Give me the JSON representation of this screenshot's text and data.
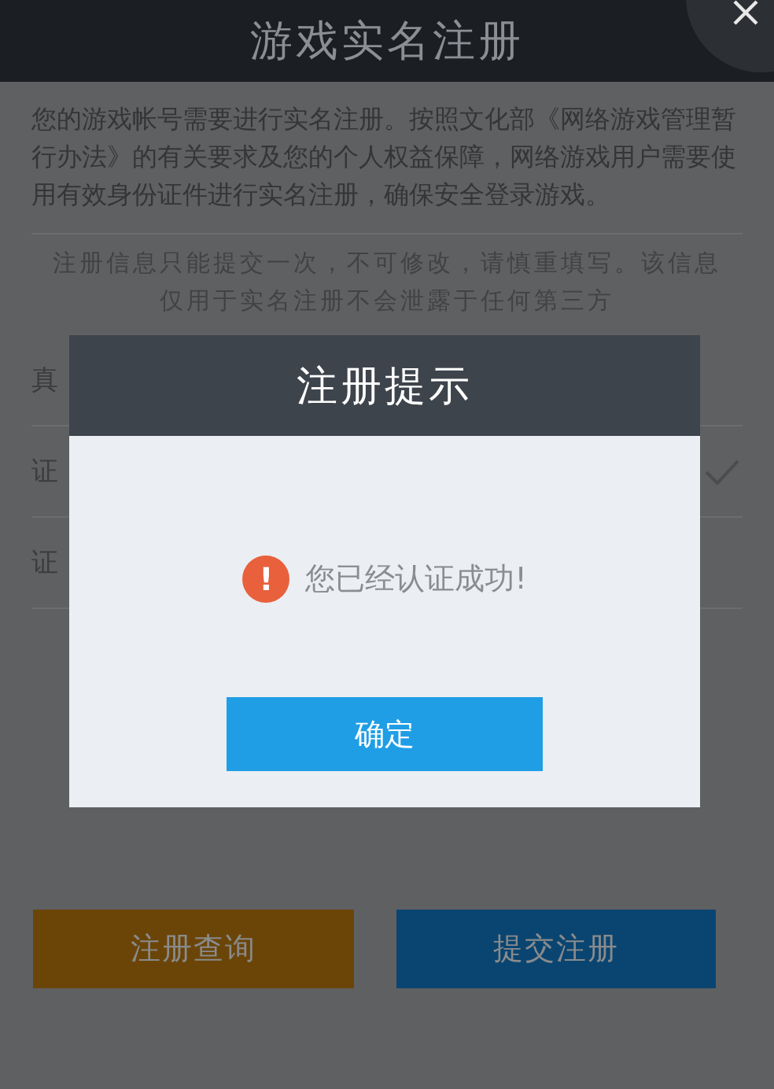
{
  "header": {
    "title": "游戏实名注册"
  },
  "intro": "您的游戏帐号需要进行实名注册。按照文化部《网络游戏管理暂行办法》的有关要求及您的个人权益保障，网络游戏用户需要使用有效身份证件进行实名注册，确保安全登录游戏。",
  "notice": [
    "注册信息只能提交一次，不可修改，请慎重填写。该信息",
    "仅用于实名注册不会泄露于任何第三方"
  ],
  "fields": [
    {
      "label": "真",
      "verified": false
    },
    {
      "label": "证",
      "verified": true
    },
    {
      "label": "证",
      "verified": false
    }
  ],
  "buttons": [
    {
      "label": "注册查询",
      "kind": "secondary"
    },
    {
      "label": "提交注册",
      "kind": "primary"
    }
  ],
  "dialog": {
    "title": "注册提示",
    "icon": "!",
    "message": "您已经认证成功!",
    "button": "确定"
  }
}
